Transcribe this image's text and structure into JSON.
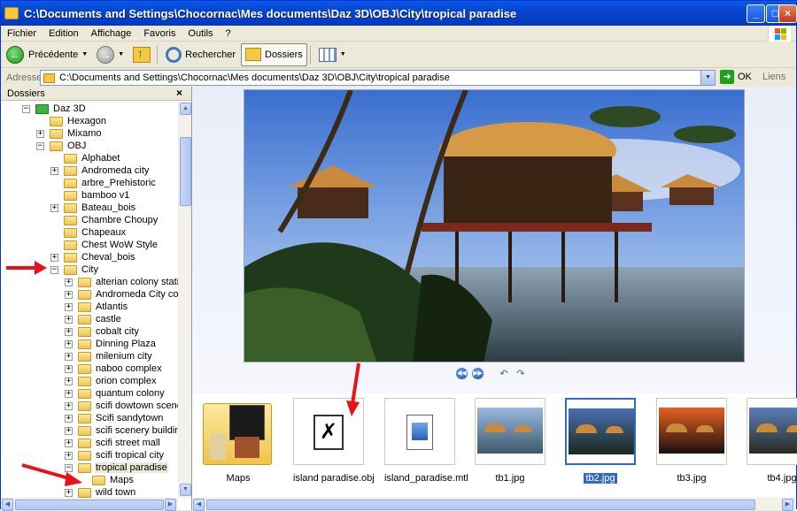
{
  "window": {
    "title": "C:\\Documents and Settings\\Chocornac\\Mes documents\\Daz 3D\\OBJ\\City\\tropical  paradise"
  },
  "menu": [
    "Fichier",
    "Edition",
    "Affichage",
    "Favoris",
    "Outils",
    "?"
  ],
  "toolbar": {
    "back_label": "Précédente",
    "search_label": "Rechercher",
    "folders_label": "Dossiers"
  },
  "address": {
    "label": "Adresse",
    "value": "C:\\Documents and Settings\\Chocornac\\Mes documents\\Daz 3D\\OBJ\\City\\tropical  paradise",
    "go_label": "OK",
    "links_label": "Liens"
  },
  "folder_panel": {
    "header": "Dossiers",
    "close": "×",
    "tree": [
      {
        "label": "Daz 3D",
        "expander": "−",
        "folder_color": "green"
      },
      {
        "label": "Hexagon",
        "expander": ""
      },
      {
        "label": "Mixamo",
        "expander": "+"
      },
      {
        "label": "OBJ",
        "expander": "−"
      },
      {
        "label": "Alphabet",
        "expander": ""
      },
      {
        "label": "Andromeda city",
        "expander": "+"
      },
      {
        "label": "arbre_Prehistoric",
        "expander": ""
      },
      {
        "label": "bamboo v1",
        "expander": ""
      },
      {
        "label": "Bateau_bois",
        "expander": "+"
      },
      {
        "label": "Chambre Choupy",
        "expander": ""
      },
      {
        "label": "Chapeaux",
        "expander": ""
      },
      {
        "label": "Chest WoW Style",
        "expander": ""
      },
      {
        "label": "Cheval_bois",
        "expander": "+"
      },
      {
        "label": "City",
        "expander": "−"
      },
      {
        "label": "alterian colony station",
        "expander": "+"
      },
      {
        "label": "Andromeda City complex",
        "expander": "+"
      },
      {
        "label": "Atlantis",
        "expander": "+"
      },
      {
        "label": "castle",
        "expander": "+"
      },
      {
        "label": "cobalt city",
        "expander": "+"
      },
      {
        "label": "Dinning Plaza",
        "expander": "+"
      },
      {
        "label": "milenium city",
        "expander": "+"
      },
      {
        "label": "naboo complex",
        "expander": "+"
      },
      {
        "label": "orion complex",
        "expander": "+"
      },
      {
        "label": "quantum colony",
        "expander": "+"
      },
      {
        "label": "scifi dowtown scenery",
        "expander": "+"
      },
      {
        "label": "Scifi sandytown",
        "expander": "+"
      },
      {
        "label": "scifi scenery building",
        "expander": "+"
      },
      {
        "label": "scifi street mall",
        "expander": "+"
      },
      {
        "label": "scifi tropical city",
        "expander": "+"
      },
      {
        "label": "tropical  paradise",
        "expander": "−",
        "selected": true
      },
      {
        "label": "Maps",
        "expander": ""
      },
      {
        "label": "wild town",
        "expander": "+"
      }
    ]
  },
  "filmstrip": [
    {
      "label": "Maps",
      "kind": "folder"
    },
    {
      "label": "island paradise.obj",
      "kind": "obj"
    },
    {
      "label": "island_paradise.mtl",
      "kind": "mtl"
    },
    {
      "label": "tb1.jpg",
      "kind": "image"
    },
    {
      "label": "tb2.jpg",
      "kind": "image",
      "selected": true
    },
    {
      "label": "tb3.jpg",
      "kind": "image"
    },
    {
      "label": "tb4.jpg",
      "kind": "image"
    }
  ],
  "colors": {
    "titlebar": "#0545d0",
    "selection": "#316ac5",
    "annotation_arrow": "#e8121a"
  }
}
